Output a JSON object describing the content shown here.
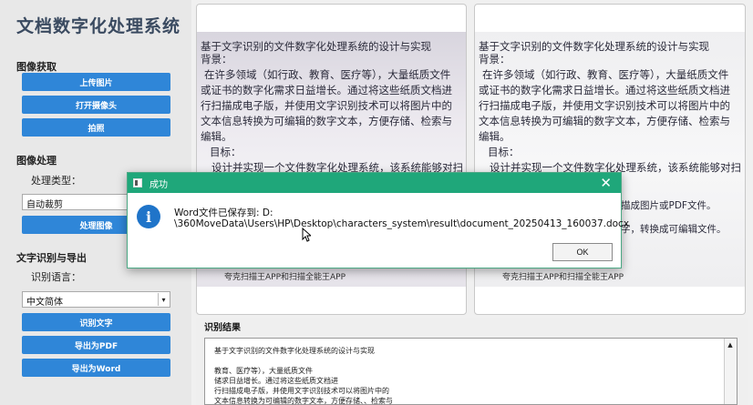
{
  "sidebar": {
    "title": "文档数字化处理系统",
    "image_acquire": {
      "label": "图像获取",
      "upload": "上传图片",
      "open_camera": "打开摄像头",
      "take_photo": "拍照"
    },
    "image_process": {
      "label": "图像处理",
      "type_label": "处理类型：",
      "type_value": "自动裁剪",
      "process_button": "处理图像"
    },
    "ocr": {
      "label": "文字识别与导出",
      "language_label": "识别语言：",
      "language_value": "中文简体",
      "recognize": "识别文字",
      "export_pdf": "导出为PDF",
      "export_word": "导出为Word"
    }
  },
  "original_image": {
    "lines": [
      "基于文字识别的文件数字化处理系统的设计与实现",
      "背景：",
      "在许多领域（如行政、教育、医疗等），大量纸质文件",
      "或证书的数字化需求日益增长。通过将这些纸质文档进",
      "行扫描成电子版，并使用文字识别技术可以将图片中的",
      "文本信息转换为可编辑的数字文本，方便存储、检索与",
      "编辑。",
      "目标：",
      "设计并实现一个文件数字化处理系统，该系统能够对扫"
    ],
    "footer": "夸克扫描王APP和扫描全能王APP"
  },
  "processed_image": {
    "lines": [
      "基于文字识别的文件数字化处理系统的设计与实现",
      "背景：",
      "在许多领域（如行政、教育、医疗等），大量纸质文件",
      "或证书的数字化需求日益增长。通过将这些纸质文档进",
      "行扫描成电子版，并使用文字识别技术可以将图片中的",
      "文本信息转换为可编辑的数字文本，方便存储、检索与",
      "编辑。",
      "目标：",
      "设计并实现一个文件数字化处理系统，该系统能够对扫"
    ],
    "partial1": "描成图片或PDF文件。",
    "partial2": "字，转换成可编辑文件。",
    "footer": "夸克扫描王APP和扫描全能王APP"
  },
  "result": {
    "title": "识别结果",
    "lines": [
      "基于文字识别的文件数字化处理系统的设计与实现",
      "",
      "教育、医疗等），大量纸质文件",
      "储求日益增长。通过将这些纸质文档进",
      "行扫描成电子版，并使用文字识别技术可以将图片中的",
      "文本信息转换为可编辑的数字文本，方便存储、、检索与"
    ]
  },
  "dialog": {
    "title": "成功",
    "message_line1": "Word文件已保存到: D:",
    "message_line2": "\\360MoveData\\Users\\HP\\Desktop\\characters_system\\result\\document_20250413_160037.docx",
    "ok": "OK",
    "close_glyph": "✕",
    "info_glyph": "i"
  },
  "glyphs": {
    "dropdown": "▾",
    "scroll_up": "▲"
  }
}
